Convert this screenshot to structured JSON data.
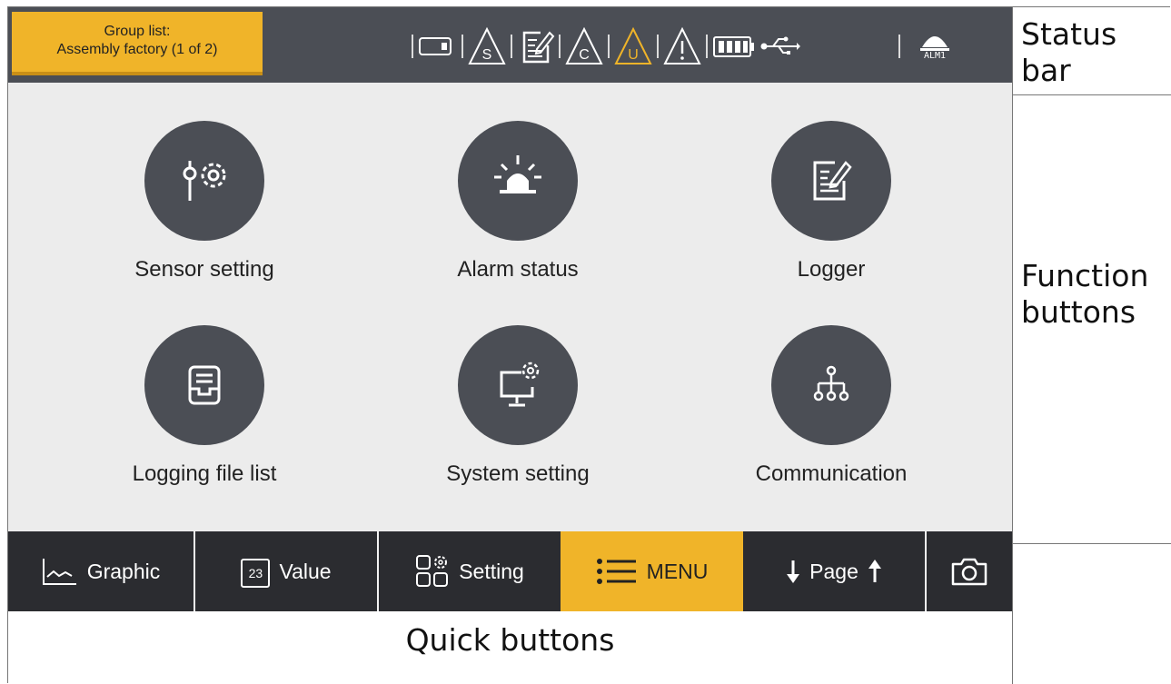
{
  "status_bar": {
    "group_line1": "Group list:",
    "group_line2": "Assembly factory (1 of 2)",
    "alarm_label": "ALM1",
    "icons": [
      "sd-card-icon",
      "sensor-warning-icon",
      "logger-icon",
      "communication-warning-icon",
      "user-warning-icon",
      "general-warning-icon",
      "battery-icon",
      "usb-icon",
      "alarm-lamp-icon"
    ]
  },
  "function_buttons": {
    "sensor_setting": "Sensor setting",
    "alarm_status": "Alarm status",
    "logger": "Logger",
    "logging_file_list": "Logging file list",
    "system_setting": "System setting",
    "communication": "Communication"
  },
  "quick_buttons": {
    "graphic": "Graphic",
    "value": "Value",
    "value_icon_text": "23",
    "setting": "Setting",
    "menu": "MENU",
    "page": "Page"
  },
  "annotations": {
    "status_bar": [
      "Status",
      "bar"
    ],
    "function_buttons": [
      "Function",
      "buttons"
    ],
    "quick_buttons": "Quick buttons"
  },
  "colors": {
    "accent": "#f0b429",
    "dark": "#4b4e55",
    "quick_bar": "#2b2c30",
    "screen_bg": "#ececec",
    "warning": "#f0b429"
  }
}
